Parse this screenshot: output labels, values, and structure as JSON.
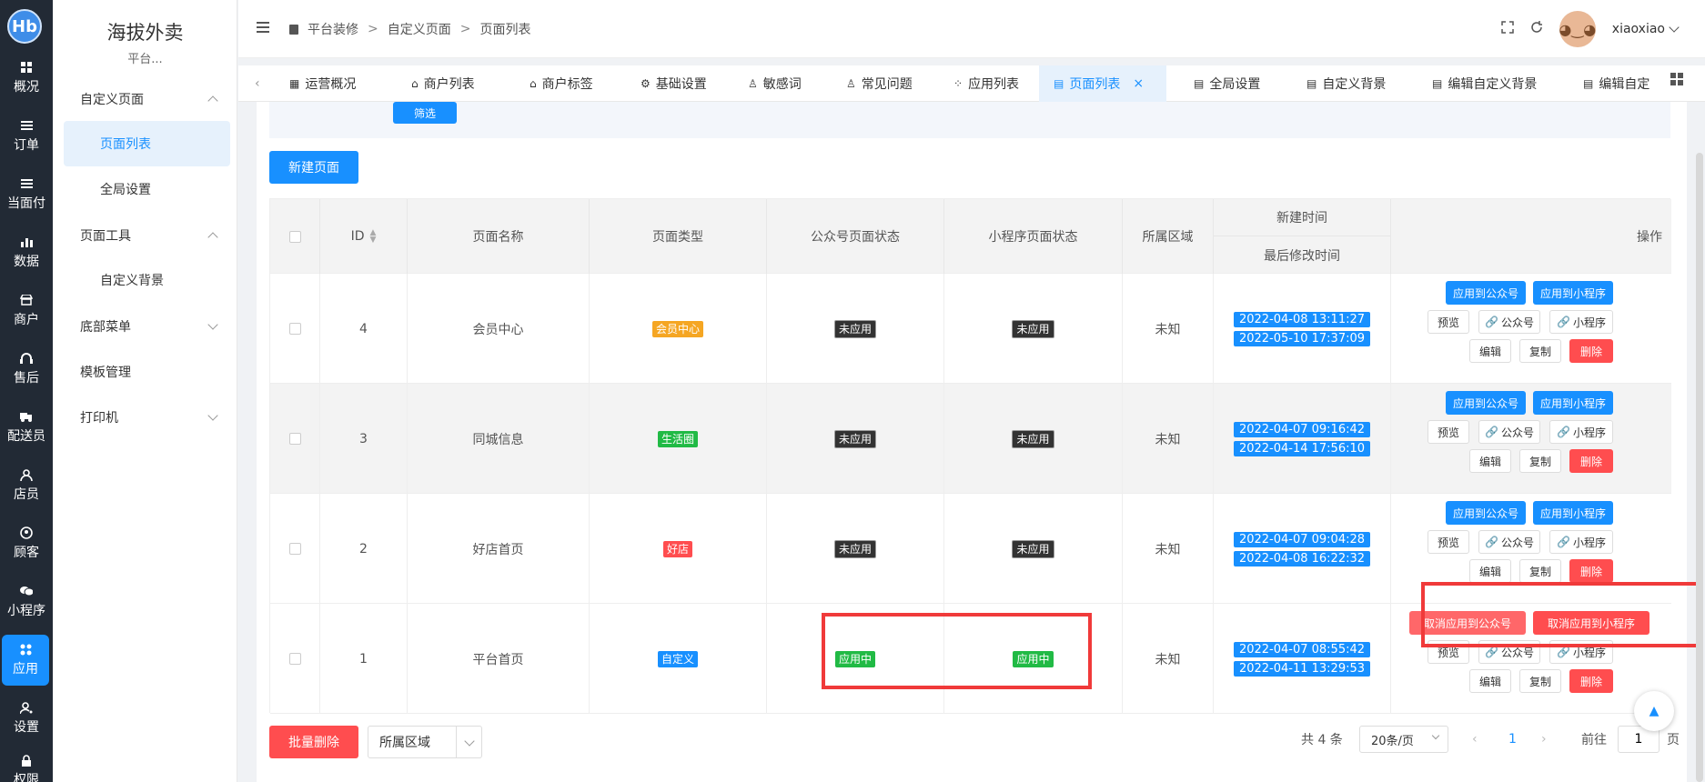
{
  "rail": {
    "logo_text": "Hb",
    "items": [
      {
        "label": "概况",
        "icon": "grid-icon"
      },
      {
        "label": "订单",
        "icon": "list-icon"
      },
      {
        "label": "当面付",
        "icon": "list-icon"
      },
      {
        "label": "数据",
        "icon": "bar-chart-icon"
      },
      {
        "label": "商户",
        "icon": "store-icon"
      },
      {
        "label": "售后",
        "icon": "headset-icon"
      },
      {
        "label": "配送员",
        "icon": "truck-icon"
      },
      {
        "label": "店员",
        "icon": "person-icon"
      },
      {
        "label": "顾客",
        "icon": "user-circle-icon"
      },
      {
        "label": "小程序",
        "icon": "chat-icon"
      },
      {
        "label": "应用",
        "icon": "apps-icon"
      },
      {
        "label": "设置",
        "icon": "settings-person-icon"
      },
      {
        "label": "权限",
        "icon": "lock-icon"
      }
    ]
  },
  "subside": {
    "brand": "海拔外卖",
    "brand_sub": "平台...",
    "groups": {
      "custom_page": "自定义页面",
      "page_list": "页面列表",
      "global_settings": "全局设置",
      "page_tools": "页面工具",
      "custom_bg": "自定义背景",
      "bottom_menu": "底部菜单",
      "template_mgmt": "模板管理",
      "printer": "打印机"
    }
  },
  "header": {
    "breadcrumbs": [
      "平台装修",
      "自定义页面",
      "页面列表"
    ],
    "username": "xiaoxiao"
  },
  "tabs": [
    {
      "label": "运营概况"
    },
    {
      "label": "商户列表"
    },
    {
      "label": "商户标签"
    },
    {
      "label": "基础设置"
    },
    {
      "label": "敏感词"
    },
    {
      "label": "常见问题"
    },
    {
      "label": "应用列表"
    },
    {
      "label": "页面列表",
      "close": "×"
    },
    {
      "label": "全局设置"
    },
    {
      "label": "自定义背景"
    },
    {
      "label": "编辑自定义背景"
    },
    {
      "label": "编辑自定"
    }
  ],
  "toolbar": {
    "filter_label": "筛选",
    "new_page_label": "新建页面"
  },
  "table": {
    "headers": {
      "id": "ID",
      "name": "页面名称",
      "type": "页面类型",
      "mp_status": "公众号页面状态",
      "mini_status": "小程序页面状态",
      "region": "所属区域",
      "created": "新建时间",
      "modified": "最后修改时间",
      "ops": "操作"
    },
    "rows": [
      {
        "id": "4",
        "name": "会员中心",
        "type": "会员中心",
        "type_color": "orange",
        "mp_status": "未应用",
        "mini_status": "未应用",
        "region": "未知",
        "created": "2022-04-08 13:11:27",
        "modified": "2022-05-10 17:37:09"
      },
      {
        "id": "3",
        "name": "同城信息",
        "type": "生活圈",
        "type_color": "green",
        "mp_status": "未应用",
        "mini_status": "未应用",
        "region": "未知",
        "created": "2022-04-07 09:16:42",
        "modified": "2022-04-14 17:56:10"
      },
      {
        "id": "2",
        "name": "好店首页",
        "type": "好店",
        "type_color": "red",
        "mp_status": "未应用",
        "mini_status": "未应用",
        "region": "未知",
        "created": "2022-04-07 09:04:28",
        "modified": "2022-04-08 16:22:32"
      },
      {
        "id": "1",
        "name": "平台首页",
        "type": "自定义",
        "type_color": "blue",
        "mp_status": "应用中",
        "mini_status": "应用中",
        "region": "未知",
        "created": "2022-04-07 08:55:42",
        "modified": "2022-04-11 13:29:53"
      }
    ],
    "ops": {
      "apply_mp": "应用到公众号",
      "apply_mini": "应用到小程序",
      "cancel_mp": "取消应用到公众号",
      "cancel_mini": "取消应用到小程序",
      "preview": "预览",
      "mp_link": "公众号",
      "mini_link": "小程序",
      "edit": "编辑",
      "copy": "复制",
      "delete": "删除"
    }
  },
  "footer": {
    "batch_delete": "批量删除",
    "region_select": "所属区域",
    "total": "共 4 条",
    "page_size": "20条/页",
    "current_page": "1",
    "goto_label": "前往",
    "goto_value": "1",
    "page_unit": "页"
  },
  "colors": {
    "primary": "#1890ff",
    "danger": "#ff4d4f",
    "rail_bg": "#222a35",
    "highlight_box": "#f03a3a"
  }
}
